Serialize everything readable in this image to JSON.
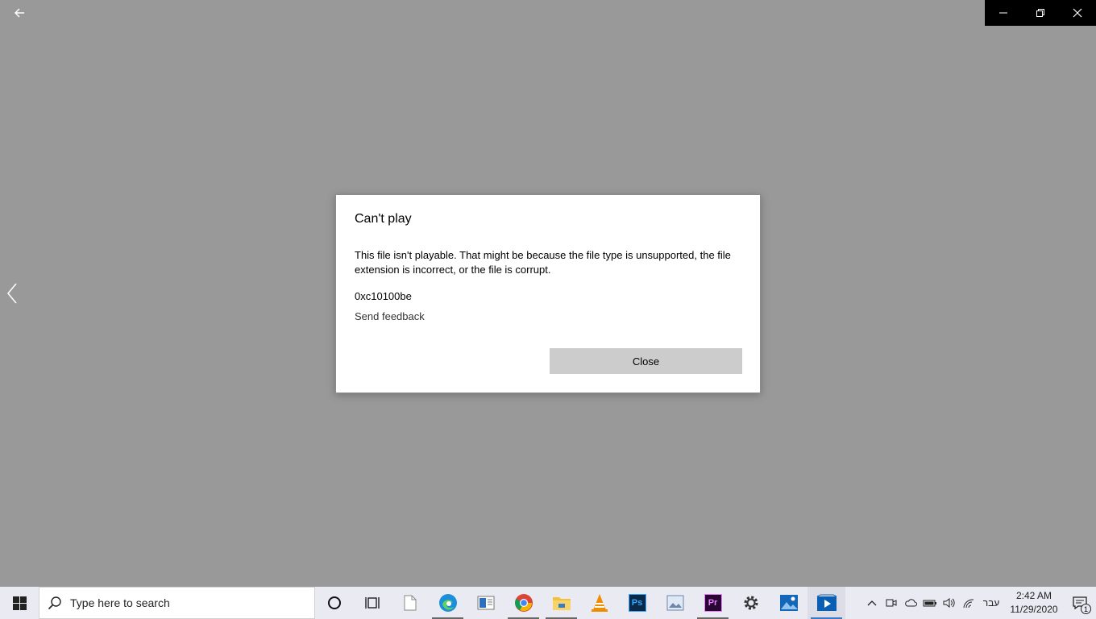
{
  "dialog": {
    "title": "Can't play",
    "message": "This file isn't playable. That might be because the file type is unsupported, the file extension is incorrect, or the file is corrupt.",
    "error_code": "0xc10100be",
    "feedback_link": "Send feedback",
    "close_label": "Close"
  },
  "taskbar": {
    "search_placeholder": "Type here to search",
    "language": "עבר",
    "time": "2:42 AM",
    "date": "11/29/2020",
    "notification_count": "1"
  },
  "colors": {
    "app_background": "#999999",
    "dialog_background": "#ffffff",
    "close_button": "#cccccc",
    "taskbar": "#e9eaf2",
    "accent": "#0078d7"
  }
}
